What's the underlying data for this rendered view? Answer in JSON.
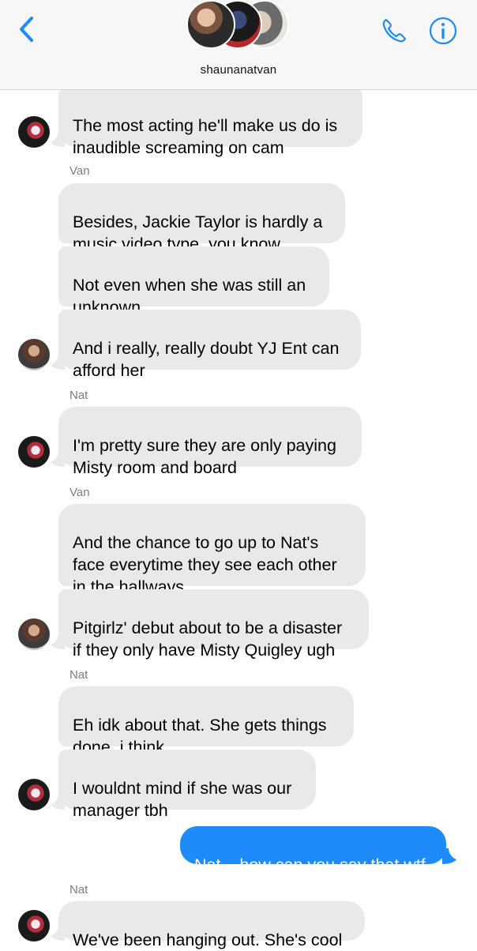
{
  "header": {
    "title": "shaunanatvan",
    "back_icon": "chevron-left-icon",
    "call_icon": "phone-icon",
    "info_icon": "info-icon",
    "accent_color": "#1f8bfa"
  },
  "messages": [
    {
      "text": "The most acting he'll make us do is\ninaudible screaming on cam",
      "from": "Nat"
    },
    {
      "sender": "Van"
    },
    {
      "text": "Besides, Jackie Taylor is hardly a\nmusic video type, you know",
      "from": "Van"
    },
    {
      "text": "Not even when she was still an\nunknown",
      "from": "Van"
    },
    {
      "text": "And i really, really doubt YJ Ent can\nafford her",
      "from": "Van"
    },
    {
      "sender": "Nat"
    },
    {
      "text": "I'm pretty sure they are only paying\nMisty room and board",
      "from": "Nat"
    },
    {
      "sender": "Van"
    },
    {
      "text": "And the chance to go up to Nat's\nface everytime they see each other\nin the hallways",
      "from": "Van"
    },
    {
      "text": "Pitgirlz' debut about to be a disaster\nif they only have Misty Quigley ugh",
      "from": "Van"
    },
    {
      "sender": "Nat"
    },
    {
      "text": "Eh idk about that. She gets things\ndone, i think",
      "from": "Nat"
    },
    {
      "text": "I wouldnt mind if she was our\nmanager tbh",
      "from": "Nat"
    },
    {
      "text": "Nat... how can you say that wtf",
      "from": "me"
    },
    {
      "sender": "Nat"
    },
    {
      "text": "We've been hanging out. She's cool",
      "from": "Nat"
    }
  ],
  "senders": {
    "van_1": "Van",
    "nat_1": "Nat",
    "van_2": "Van",
    "nat_2": "Nat",
    "nat_3": "Nat"
  },
  "bubbles": {
    "m1": "The most acting he'll make us do is\ninaudible screaming on cam",
    "m2": "Besides, Jackie Taylor is hardly a\nmusic video type, you know",
    "m3": "Not even when she was still an\nunknown",
    "m4": "And i really, really doubt YJ Ent can\nafford her",
    "m5": "I'm pretty sure they are only paying\nMisty room and board",
    "m6": "And the chance to go up to Nat's\nface everytime they see each other\nin the hallways",
    "m7": "Pitgirlz' debut about to be a disaster\nif they only have Misty Quigley ugh",
    "m8": "Eh idk about that. She gets things\ndone, i think",
    "m9": "I wouldnt mind if she was our\nmanager tbh",
    "m10": "Nat... how can you say that wtf",
    "m11": "We've been hanging out. She's cool"
  }
}
